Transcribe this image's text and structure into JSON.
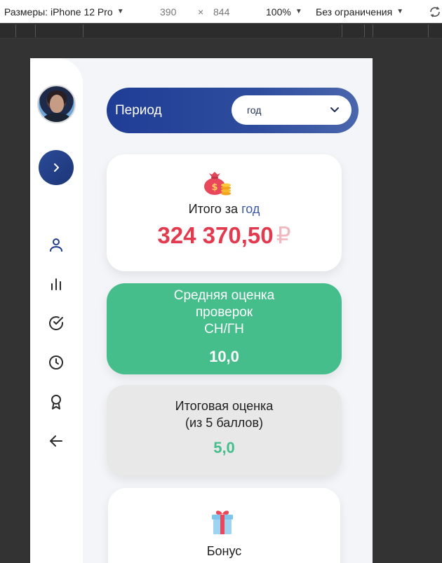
{
  "devtools": {
    "device_label": "Размеры: iPhone 12 Pro",
    "width": "390",
    "times": "×",
    "height": "844",
    "zoom": "100%",
    "throttle": "Без ограничения"
  },
  "sidebar": {
    "avatar_alt": "avatar",
    "nav_icons": [
      "user-icon",
      "bar-chart-icon",
      "check-circle-icon",
      "clock-icon",
      "award-icon",
      "arrow-left-icon"
    ]
  },
  "period": {
    "label": "Период",
    "selected": "год"
  },
  "total_card": {
    "title_prefix": "Итого за",
    "title_period": "год",
    "amount": "324 370,50",
    "currency": "₽"
  },
  "avg_card": {
    "title_line1": "Средняя оценка",
    "title_line2": "проверок",
    "title_line3": "СН/ГН",
    "value": "10,0"
  },
  "final_card": {
    "title_line1": "Итоговая оценка",
    "title_line2": "(из 5 баллов)",
    "value": "5,0"
  },
  "bonus_card": {
    "title": "Бонус"
  },
  "colors": {
    "accent_blue": "#1f3d95",
    "red": "#e23a4e",
    "green": "#45be8c"
  }
}
